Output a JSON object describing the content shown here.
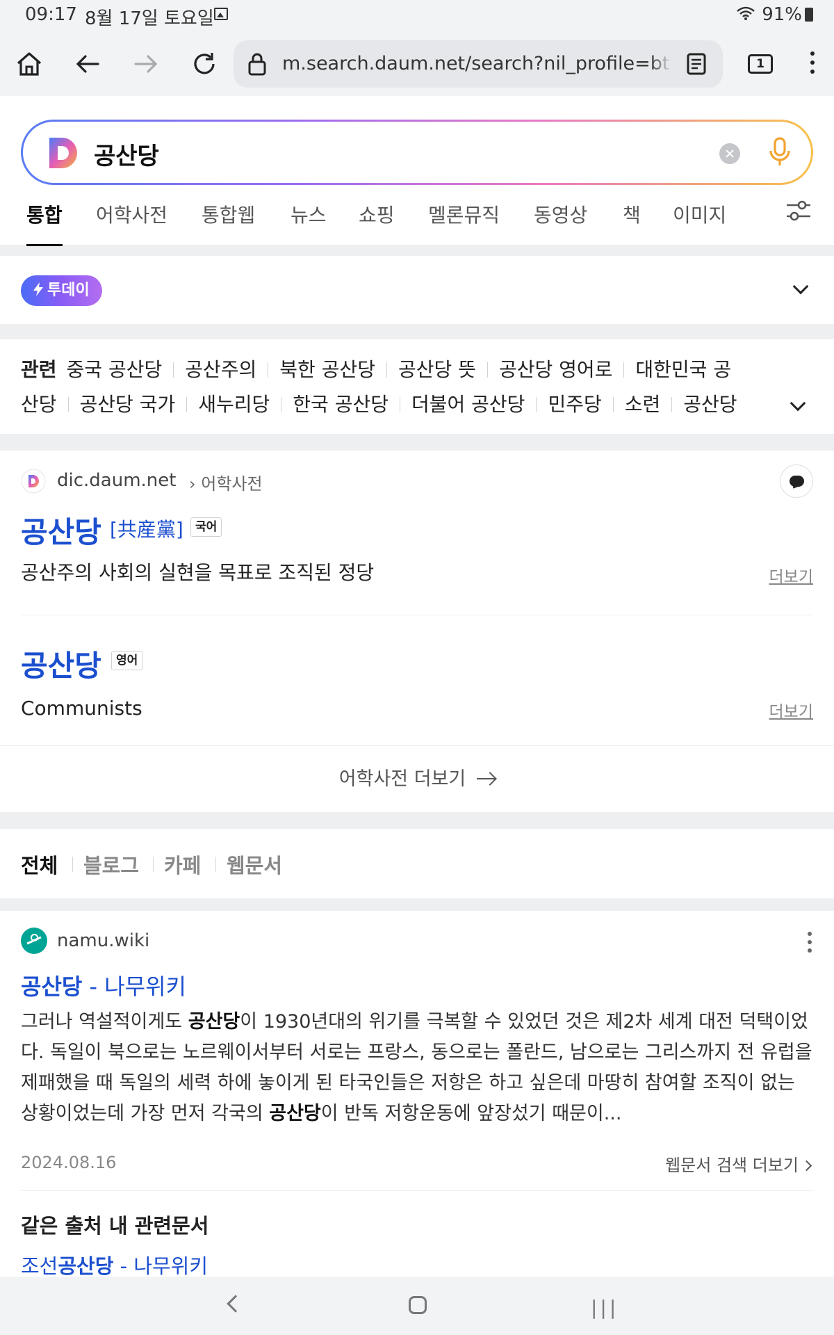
{
  "status_bar": {
    "time": "09:17",
    "date": "8월 17일 토요일",
    "battery": "91%"
  },
  "browser": {
    "url": "m.search.daum.net/search?nil_profile=btn&w",
    "tab_count": "1"
  },
  "search": {
    "query": "공산당"
  },
  "tabs": [
    "통합",
    "어학사전",
    "통합웹",
    "뉴스",
    "쇼핑",
    "멜론뮤직",
    "동영상",
    "책",
    "이미지"
  ],
  "today": {
    "badge": "투데이"
  },
  "related": {
    "label": "관련",
    "line1": [
      "중국 공산당",
      "공산주의",
      "북한 공산당",
      "공산당 뜻",
      "공산당 영어로",
      "대한민국 공"
    ],
    "line2": [
      "산당",
      "공산당 국가",
      "새누리당",
      "한국 공산당",
      "더불어 공산당",
      "민주당",
      "소련",
      "공산당"
    ]
  },
  "dictionary": {
    "source": "dic.daum.net",
    "crumb": "어학사전",
    "entries": [
      {
        "word": "공산당",
        "hanja": "[共産黨]",
        "lang": "국어",
        "meaning": "공산주의 사회의 실현을 목표로 조직된 정당",
        "more": "더보기"
      },
      {
        "word": "공산당",
        "lang": "영어",
        "meaning": "Communists",
        "more": "더보기"
      }
    ],
    "more_label": "어학사전 더보기"
  },
  "filters": [
    "전체",
    "블로그",
    "카페",
    "웹문서"
  ],
  "result": {
    "site": "namu.wiki",
    "title_bold": "공산당",
    "title_rest": " - 나무위키",
    "snippet": [
      {
        "t": "그러나 역설적이게도 ",
        "b": false
      },
      {
        "t": "공산당",
        "b": true
      },
      {
        "t": "이 1930년대의 위기를 극복할 수 있었던 것은 제2차 세계 대전 덕택이었다. 독일이 북으로는 노르웨이서부터 서로는 프랑스, 동으로는 폴란드, 남으로는 그리스까지 전 유럽을 제패했을 때 독일의 세력 하에 놓이게 된 타국인들은 저항은 하고 싶은데 마땅히 참여할 조직이 없는 상황이었는데 가장 먼저 각국의 ",
        "b": false
      },
      {
        "t": "공산당",
        "b": true
      },
      {
        "t": "이 반독 저항운동에 앞장섰기 때문이...",
        "b": false
      }
    ],
    "date": "2024.08.16",
    "web_more": "웹문서 검색 더보기",
    "same_source_label": "같은 출처 내 관련문서",
    "related_doc_prefix": "조선",
    "related_doc_bold": "공산당",
    "related_doc_rest": " - 나무위키"
  },
  "colors": {
    "link_blue": "#1b4fcf",
    "page_bg": "#eeeff1"
  }
}
